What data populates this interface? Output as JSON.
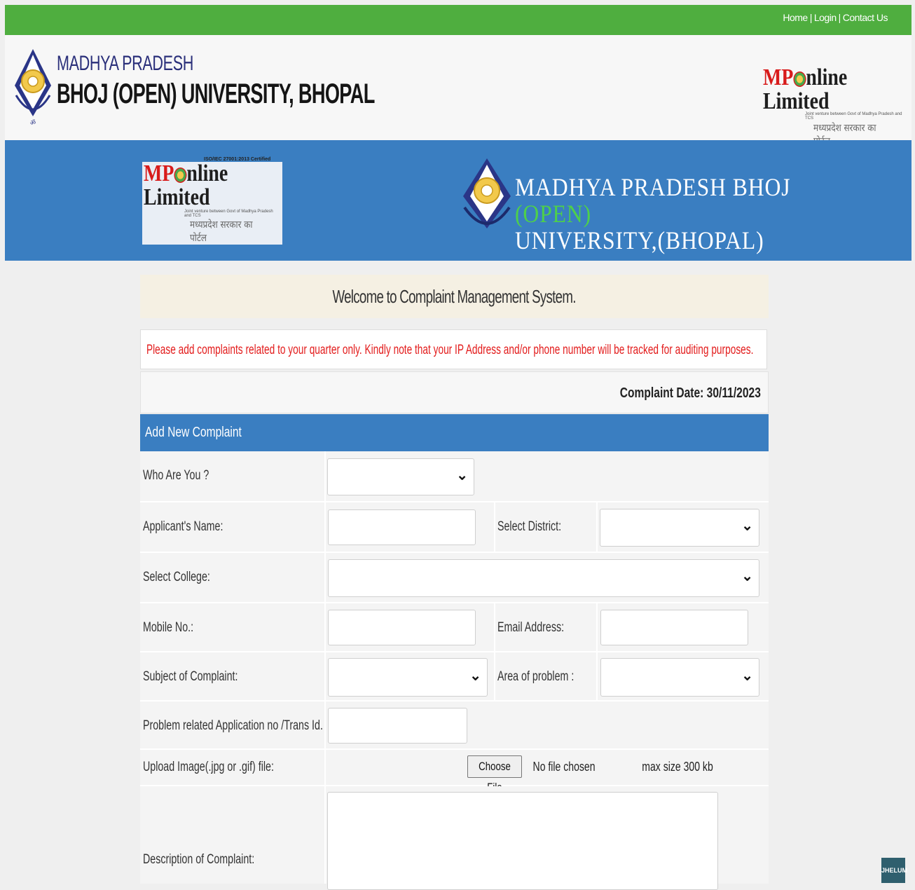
{
  "topnav": {
    "home": "Home",
    "login": "Login",
    "contact": "Contact Us",
    "separator": "|"
  },
  "header": {
    "university_line1": "MADHYA PRADESH",
    "university_line2": "BHOJ (OPEN) UNIVERSITY, BHOPAL",
    "partner_logo": {
      "mp": "MP",
      "rest": "nline Limited",
      "tagline": "Joint venture between Govt of Madhya Pradesh and TCS",
      "hindi": "मध्यप्रदेश सरकार का पोर्टल"
    }
  },
  "banner": {
    "logo": {
      "iso": "ISO/IEC 27001:2013 Certified",
      "mp": "MP",
      "rest": "nline Limited",
      "tagline": "Joint venture between Govt of Madhya Pradesh and TCS",
      "hindi": "मध्यप्रदेश सरकार का पोर्टल"
    },
    "title_part1": "MADHYA PRADESH BHOJ ",
    "title_open": "(OPEN)",
    "title_line2": "UNIVERSITY,(BHOPAL)"
  },
  "main": {
    "welcome": "Welcome to Complaint Management System.",
    "notice": "Please add complaints related to your quarter only. Kindly note that your IP Address and/or phone number will be tracked for auditing purposes.",
    "complaint_date": "Complaint Date: 30/11/2023",
    "section_title": "Add New Complaint"
  },
  "form": {
    "who_are_you": "Who Are You ?",
    "applicant_name": "Applicant's Name:",
    "select_district": "Select District:",
    "select_college": "Select College:",
    "mobile_no": "Mobile No.:",
    "email_address": "Email Address:",
    "subject": "Subject of Complaint:",
    "area_of_problem": "Area of problem :",
    "problem_app_no": "Problem related Application no /Trans Id.",
    "upload_image": "Upload Image(.jpg or .gif) file:",
    "choose_file": "Choose File",
    "no_file": "No file chosen",
    "max_size": "max size 300 kb",
    "description": "Description of Complaint:"
  },
  "badge": "JHELUM",
  "colors": {
    "topbar": "#4fae3f",
    "banner": "#3a7ec1",
    "notice_text": "#e31c1c",
    "open_text": "#4ed04a"
  }
}
